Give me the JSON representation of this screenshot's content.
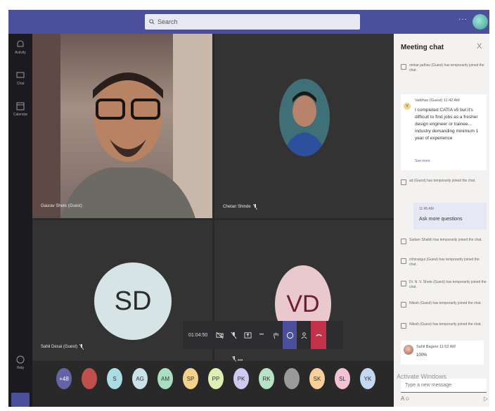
{
  "search": {
    "placeholder": "Search"
  },
  "rail": {
    "items": [
      {
        "label": "Activity",
        "icon": "bell-icon"
      },
      {
        "label": "Chat",
        "icon": "chat-icon"
      },
      {
        "label": "Calendar",
        "icon": "calendar-icon"
      },
      {
        "label": "Help",
        "icon": "help-icon"
      }
    ]
  },
  "tiles": {
    "one": {
      "name": "Gaurav Shete (Guest)"
    },
    "two": {
      "name": "Chetan Shinde"
    },
    "three": {
      "name": "Sahil Desai (Guest)",
      "initials": "SD",
      "color": "#d6e4e6"
    },
    "four": {
      "initials": "VD",
      "color": "#e9c9cd"
    }
  },
  "controls": {
    "timer": "01:04:50",
    "more": "•••",
    "hangup_color": "#c4314b",
    "accent": "#4b4f9c"
  },
  "sharing": {
    "label": "•••"
  },
  "participants": [
    {
      "initials": "+48",
      "color": "#6264a7"
    },
    {
      "initials": "",
      "color": "#c0504d"
    },
    {
      "initials": "S",
      "color": "#a9dce3"
    },
    {
      "initials": "AG",
      "color": "#c9e4e8"
    },
    {
      "initials": "AM",
      "color": "#a8dfc1"
    },
    {
      "initials": "SP",
      "color": "#f3d28b"
    },
    {
      "initials": "PP",
      "color": "#dcefb5"
    },
    {
      "initials": "PK",
      "color": "#cdc9f0"
    },
    {
      "initials": "RK",
      "color": "#b6e3c6"
    },
    {
      "initials": "",
      "color": "#9a9a9a"
    },
    {
      "initials": "SK",
      "color": "#f6cf9b"
    },
    {
      "initials": "SL",
      "color": "#f2c2d4"
    },
    {
      "initials": "YK",
      "color": "#c4d8f2"
    }
  ],
  "chat": {
    "title": "Meeting chat",
    "close": "X",
    "sys_top": "omkar jadhav (Guest) has temporarily joined the chat.",
    "vaibhav": {
      "initial": "V",
      "meta": "Vaibhav (Guest)  11:42 AM",
      "body": "I completed CATIA v5 but it's difficult to find jobs as a fresher design engineer or trainee... industry demanding minimum 1 year of experience",
      "see_more": "See more"
    },
    "sys_ad": "ad (Guest) has temporarily joined the chat.",
    "ask": {
      "meta": "11:45 AM",
      "body": "Ask more questions"
    },
    "system_events": [
      "Sadanr Shaikh has temporarily joined the chat.",
      "chhirangui (Guest) has temporarily joined the chat.",
      "Dr. N. V. Shete (Guest) has temporarily joined the chat.",
      "Nilesh (Guest) has temporarily joined the chat.",
      "Nilesh (Guest) has temporarily joined the chat."
    ],
    "sahil": {
      "meta": "Sahil Bagare  11:52 AM",
      "body": "100%"
    },
    "compose_placeholder": "Type a new message",
    "watermark": "Activate Windows"
  }
}
